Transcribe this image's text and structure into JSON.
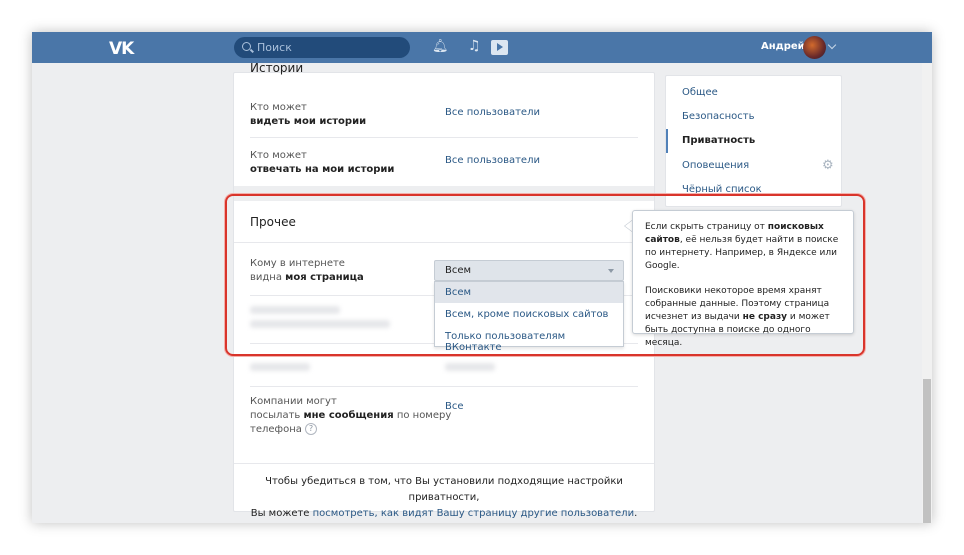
{
  "header": {
    "logo": "VK",
    "search_placeholder": "Поиск",
    "user_name": "Андрей"
  },
  "stories": {
    "title": "Истории",
    "rows": [
      {
        "label_top": "Кто может",
        "label_bold": "видеть мои истории",
        "value": "Все пользователи"
      },
      {
        "label_top": "Кто может",
        "label_bold": "отвечать на мои истории",
        "value": "Все пользователи"
      }
    ]
  },
  "other": {
    "title": "Прочее",
    "visibility_row": {
      "label_top": "Кому в интернете",
      "label_prefix": "видна ",
      "label_bold": "моя страница"
    },
    "select": {
      "value": "Всем",
      "options": [
        "Всем",
        "Всем, кроме поисковых сайтов",
        "Только пользователям ВКонтакте"
      ]
    },
    "companies_row": {
      "line1": "Компании могут",
      "line2_prefix": "посылать ",
      "line2_bold": "мне сообщения",
      "line2_suffix": " по номеру",
      "line3": "телефона",
      "help": "?",
      "value": "Все"
    }
  },
  "footer": {
    "line1": "Чтобы убедиться в том, что Вы установили подходящие настройки приватности,",
    "line2_prefix": "Вы можете ",
    "link": "посмотреть, как видят Вашу страницу другие пользователи",
    "line2_suffix": "."
  },
  "menu": {
    "items": [
      "Общее",
      "Безопасность",
      "Приватность",
      "Оповещения",
      "Чёрный список"
    ],
    "active_index": 2
  },
  "tooltip": {
    "p1_a": "Если скрыть страницу от ",
    "p1_bold": "поисковых сайтов",
    "p1_b": ", её нельзя будет найти в поиске по интернету. Например, в Яндексе или Google.",
    "p2_a": "Поисковики некоторое время хранят собранные данные. Поэтому страница исчезнет из выдачи ",
    "p2_bold": "не сразу",
    "p2_b": " и может быть доступна в поиске до одного месяца."
  },
  "colors": {
    "header_bg": "#4a76a8",
    "link": "#2a5885",
    "highlight": "#d9342b"
  }
}
